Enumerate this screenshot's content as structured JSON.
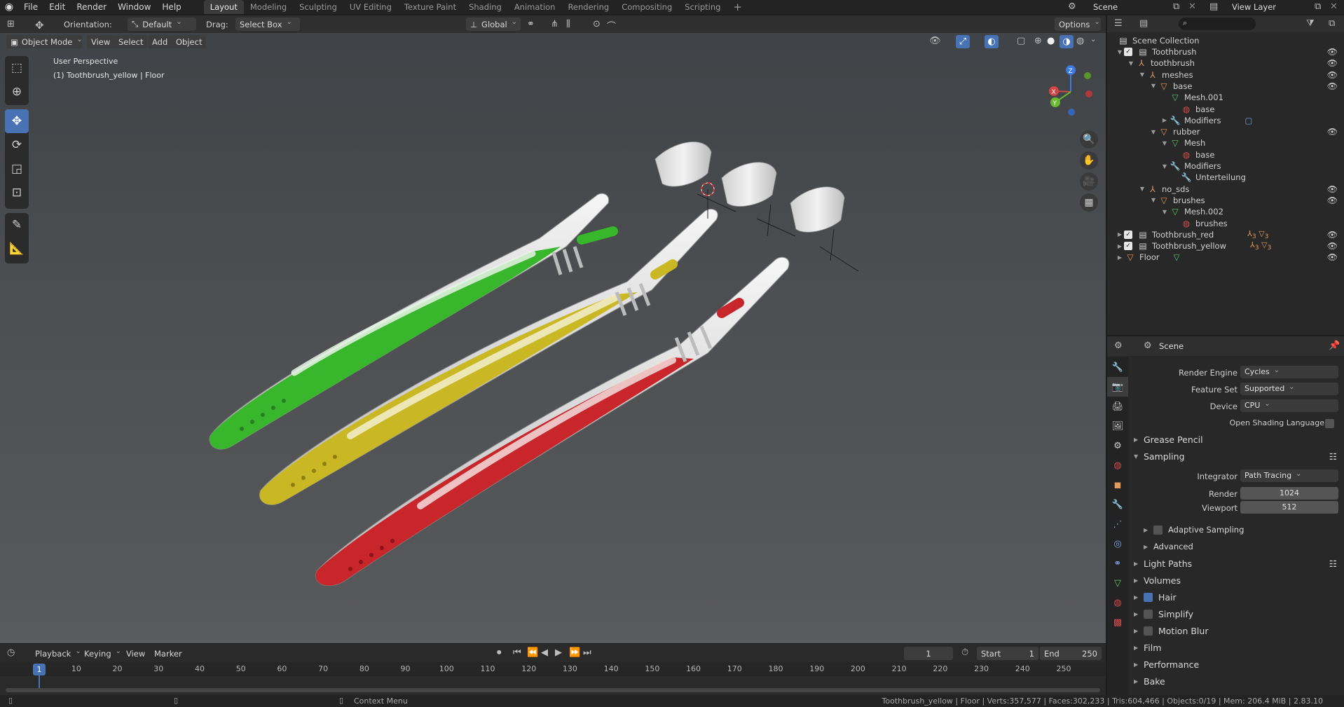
{
  "topbar": {
    "menus": [
      "File",
      "Edit",
      "Render",
      "Window",
      "Help"
    ],
    "workspaces": [
      "Layout",
      "Modeling",
      "Sculpting",
      "UV Editing",
      "Texture Paint",
      "Shading",
      "Animation",
      "Rendering",
      "Compositing",
      "Scripting"
    ],
    "active_workspace": "Layout",
    "add_tab": "+",
    "scene_name": "Scene",
    "view_layer": "View Layer"
  },
  "vp_header": {
    "orientation_label": "Orientation:",
    "orientation_value": "Default",
    "drag_label": "Drag:",
    "drag_value": "Select Box",
    "transform_orientation": "Global",
    "options": "Options"
  },
  "vp_subheader": {
    "mode": "Object Mode",
    "menus": [
      "View",
      "Select",
      "Add",
      "Object"
    ]
  },
  "overlay": {
    "perspective": "User Perspective",
    "active_object": "(1) Toothbrush_yellow | Floor"
  },
  "gizmo": {
    "x": "X",
    "y": "Y",
    "z": "Z"
  },
  "timeline": {
    "menus": [
      "Playback",
      "Keying",
      "View",
      "Marker"
    ],
    "current_frame": "1",
    "start_label": "Start",
    "start_value": "1",
    "end_label": "End",
    "end_value": "250",
    "ruler": [
      "1",
      "10",
      "20",
      "30",
      "40",
      "50",
      "60",
      "70",
      "80",
      "90",
      "100",
      "110",
      "120",
      "130",
      "140",
      "150",
      "160",
      "170",
      "180",
      "190",
      "200",
      "210",
      "220",
      "230",
      "240",
      "250"
    ]
  },
  "status": {
    "context_menu": "Context Menu",
    "stats": "Toothbrush_yellow | Floor | Verts:357,577 | Faces:302,233 | Tris:604,466 | Objects:0/19 | Mem: 206.4 MiB | 2.83.10"
  },
  "outliner": {
    "root": "Scene Collection",
    "rows": [
      {
        "label": "Toothbrush",
        "type": "collection",
        "color": "#cfcfcf"
      },
      {
        "label": "toothbrush",
        "type": "empty",
        "color": "#e39a5a"
      },
      {
        "label": "meshes",
        "type": "empty",
        "color": "#e39a5a"
      },
      {
        "label": "base",
        "type": "object",
        "color": "#e39a5a"
      },
      {
        "label": "Mesh.001",
        "type": "mesh",
        "color": "#5fc66d"
      },
      {
        "label": "base",
        "type": "material",
        "color": "#d44b4b"
      },
      {
        "label": "Modifiers",
        "type": "modifier",
        "color": "#7ea4e6"
      },
      {
        "label": "rubber",
        "type": "object",
        "color": "#e39a5a"
      },
      {
        "label": "Mesh",
        "type": "mesh",
        "color": "#5fc66d"
      },
      {
        "label": "base",
        "type": "material",
        "color": "#d44b4b"
      },
      {
        "label": "Modifiers",
        "type": "modifier",
        "color": "#7ea4e6"
      },
      {
        "label": "Unterteilung",
        "type": "modifier",
        "color": "#7ea4e6"
      },
      {
        "label": "no_sds",
        "type": "empty",
        "color": "#e39a5a"
      },
      {
        "label": "brushes",
        "type": "object",
        "color": "#e39a5a"
      },
      {
        "label": "Mesh.002",
        "type": "mesh",
        "color": "#5fc66d"
      },
      {
        "label": "brushes",
        "type": "material",
        "color": "#d44b4b"
      },
      {
        "label": "Toothbrush_red",
        "type": "collection",
        "color": "#cfcfcf"
      },
      {
        "label": "Toothbrush_yellow",
        "type": "collection",
        "color": "#cfcfcf"
      },
      {
        "label": "Floor",
        "type": "object",
        "color": "#e39a5a"
      }
    ],
    "badge_red_count": "3",
    "badge_yellow_count": "3"
  },
  "properties": {
    "context": "Scene",
    "render_engine_label": "Render Engine",
    "render_engine": "Cycles",
    "feature_set_label": "Feature Set",
    "feature_set": "Supported",
    "device_label": "Device",
    "device": "CPU",
    "osl_label": "Open Shading Language",
    "sections": {
      "grease_pencil": "Grease Pencil",
      "sampling": "Sampling",
      "integrator_label": "Integrator",
      "integrator": "Path Tracing",
      "render_label": "Render",
      "render_samples": "1024",
      "viewport_label": "Viewport",
      "viewport_samples": "512",
      "adaptive": "Adaptive Sampling",
      "advanced": "Advanced",
      "light_paths": "Light Paths",
      "volumes": "Volumes",
      "hair": "Hair",
      "simplify": "Simplify",
      "motion_blur": "Motion Blur",
      "film": "Film",
      "performance": "Performance",
      "bake": "Bake"
    }
  },
  "colors": {
    "accent": "#4772b3",
    "brush_green": "#38b62c",
    "brush_yellow": "#c9b824",
    "brush_red": "#c8262a"
  }
}
